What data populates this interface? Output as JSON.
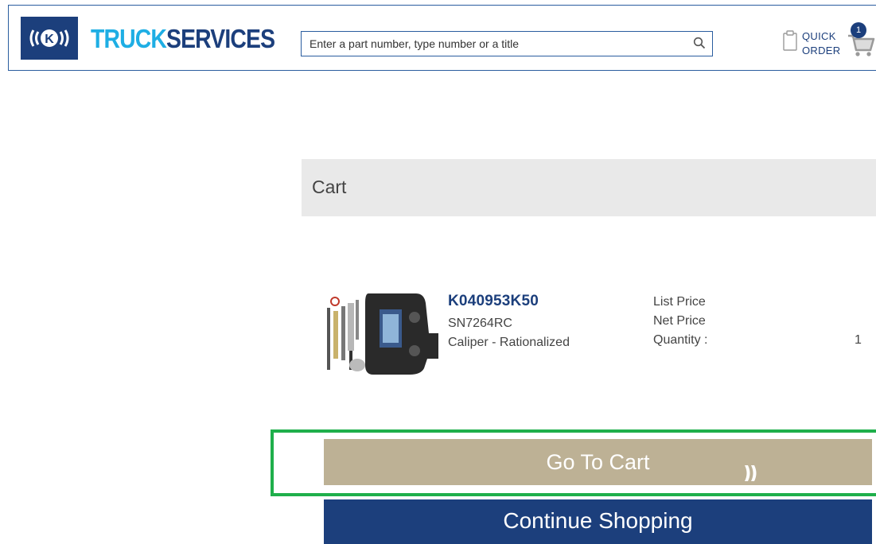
{
  "header": {
    "brand_part1": "TRUCK",
    "brand_part2": "SERVICES",
    "logo_letter": "K",
    "search_placeholder": "Enter a part number, type number or a title",
    "quick_order_label": "QUICK\nORDER",
    "cart_count": "1"
  },
  "cart": {
    "title": "Cart",
    "item": {
      "part_number": "K040953K50",
      "type_number": "SN7264RC",
      "title": "Caliper - Rationalized",
      "list_price_label": "List Price",
      "net_price_label": "Net Price",
      "quantity_label": "Quantity :",
      "quantity": "1"
    },
    "go_to_cart_label": "Go To Cart",
    "continue_shopping_label": "Continue Shopping"
  },
  "colors": {
    "brand_navy": "#1c3f7c",
    "brand_light_blue": "#1eaee4",
    "go_to_cart_bg": "#bdb195",
    "highlight_green": "#1faf4b",
    "cart_header_bg": "#e9e9e9"
  }
}
